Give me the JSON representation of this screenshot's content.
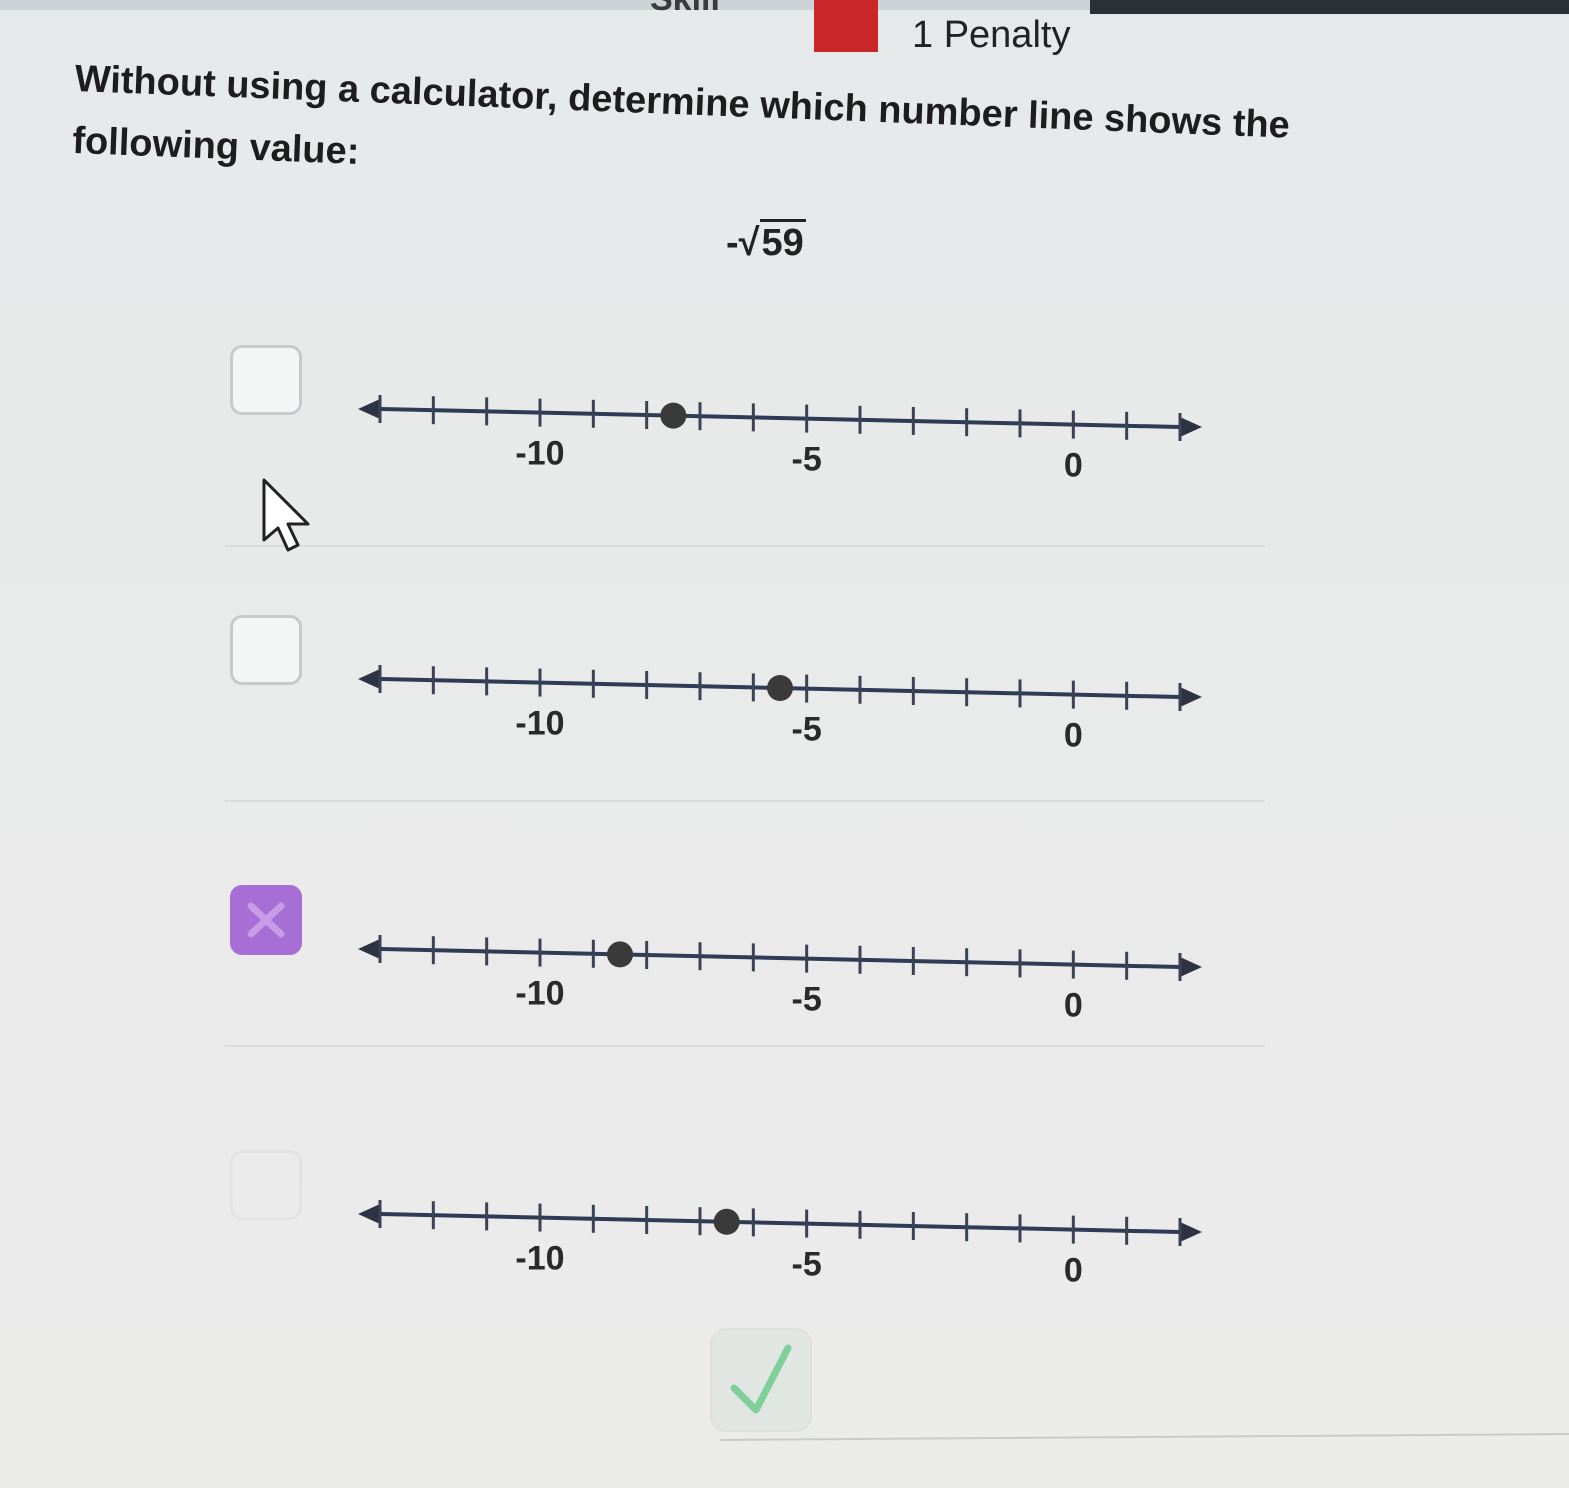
{
  "header": {
    "skill_text": "Skill",
    "penalty_label": "1 Penalty",
    "penalty_color": "#c9262a"
  },
  "question": {
    "prompt": "Without using a calculator, determine which number line shows the following value:",
    "value_sign": "-",
    "value_radicand": "59"
  },
  "options": [
    {
      "checked": false,
      "point": -7.5,
      "labels": [
        "-10",
        "-5",
        "0"
      ]
    },
    {
      "checked": false,
      "point": -5.5,
      "labels": [
        "-10",
        "-5",
        "0"
      ]
    },
    {
      "checked": true,
      "point": -8.5,
      "labels": [
        "-10",
        "-5",
        "0"
      ]
    },
    {
      "checked": false,
      "point": -6.5,
      "labels": [
        "-10",
        "-5",
        "0"
      ]
    }
  ],
  "numberline": {
    "min": -13,
    "max": 2,
    "tick_step": 1,
    "point_color": "#3a3a3a",
    "line_color": "#2f3a55"
  },
  "checkbox_checked_color": "#a76ed6",
  "submit": {
    "icon": "checkmark-icon",
    "color": "#7fcf9a"
  }
}
